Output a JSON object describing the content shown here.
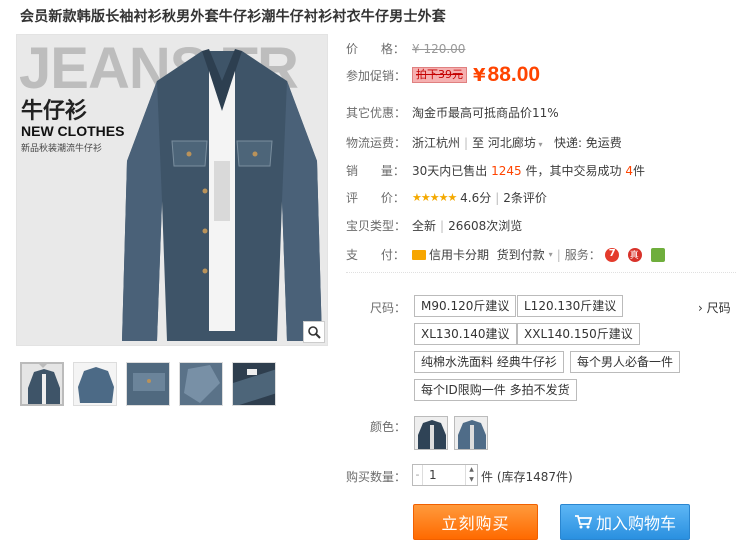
{
  "title": "会员新款韩版长袖衬衫秋男外套牛仔衫潮牛仔衬衫衬衣牛仔男士外套",
  "image": {
    "bg_word": "JEANS TR",
    "cn_heading": "牛仔衫",
    "en_heading": "NEW CLOTHES",
    "sub_text": "新品秋装潮流牛仔衫"
  },
  "price_row": {
    "label": "价      格：",
    "value": "¥ 120.00"
  },
  "promo_row": {
    "label": "参加促销：",
    "tag": "拍下39元",
    "yen": "¥",
    "price": "88.00"
  },
  "other_row": {
    "label": "其它优惠：",
    "text": "淘金币最高可抵商品价11%"
  },
  "logistics_row": {
    "label": "物流运费：",
    "from": "浙江杭州",
    "to_prefix": "至",
    "to": "河北廊坊",
    "express": "快递: 免运费"
  },
  "sales_row": {
    "label": "销      量：",
    "prefix": "30天内已售出",
    "count": "1245",
    "mid": "件，其中交易成功",
    "success": "4",
    "suffix": "件"
  },
  "rating_row": {
    "label": "评      价：",
    "stars": "★★★★★",
    "score": "4.6分",
    "reviews": "2条评价"
  },
  "type_row": {
    "label": "宝贝类型：",
    "type": "全新",
    "views": "26608次浏览"
  },
  "pay_row": {
    "label": "支      付：",
    "credit": "信用卡分期",
    "cod": "货到付款",
    "service_label": "服务："
  },
  "size": {
    "label": "尺码：",
    "options": [
      "M90.120斤建议",
      "L120.130斤建议",
      "XL130.140建议",
      "XXL140.150斤建议",
      "纯棉水洗面料 经典牛仔衫",
      "每个男人必备一件",
      "每个ID限购一件 多拍不发货"
    ],
    "overflow": "尺码"
  },
  "color": {
    "label": "颜色："
  },
  "quantity": {
    "label": "购买数量：",
    "value": "1",
    "stock": "件 (库存1487件)"
  },
  "buttons": {
    "buy": "立刻购买",
    "cart": "加入购物车"
  },
  "colors": {
    "accent": "#ff4400",
    "buy": "#ff7300",
    "cart": "#3a9be8"
  }
}
